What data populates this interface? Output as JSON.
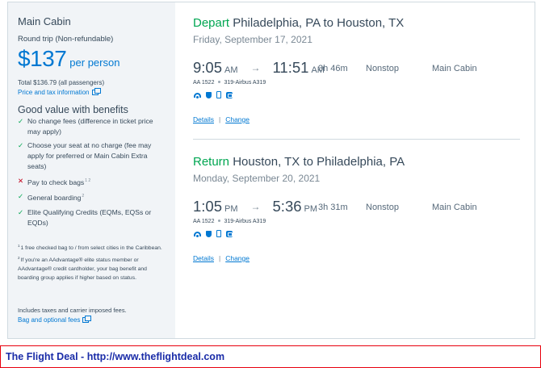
{
  "sidebar": {
    "cabin": "Main Cabin",
    "trip_type": "Round trip (Non-refundable)",
    "price": "$137",
    "per_person": "per person",
    "total": "Total $136.79 (all passengers)",
    "price_info_link": "Price and tax information",
    "benefits_title": "Good value with benefits",
    "benefits": [
      {
        "text": "No change fees (difference in ticket price may apply)",
        "included": true
      },
      {
        "text": "Choose your seat at no charge (fee may apply for preferred or Main Cabin Extra seats)",
        "included": true
      },
      {
        "text": "Pay to check bags",
        "included": false,
        "sup": "1 2"
      },
      {
        "text": "General boarding",
        "included": true,
        "sup": "2"
      },
      {
        "text": "Elite Qualifying Credits (EQMs, EQSs or EQDs)",
        "included": true
      }
    ],
    "notes": [
      {
        "sup": "1",
        "text": "1 free checked bag to / from select cities in the Caribbean."
      },
      {
        "sup": "2",
        "text": "If you're an AAdvantage® elite status member or AAdvantage® credit cardholder, your bag benefit and boarding group applies if higher based on status."
      }
    ],
    "includes": "Includes taxes and carrier imposed fees.",
    "bag_link": "Bag and optional fees"
  },
  "legs": [
    {
      "verb": "Depart",
      "route": "Philadelphia, PA to Houston, TX",
      "date": "Friday, September 17, 2021",
      "dep_time": "9:05",
      "dep_ampm": "AM",
      "arr_time": "11:51",
      "arr_ampm": "AM",
      "duration": "3h 46m",
      "stops": "Nonstop",
      "cabin": "Main Cabin",
      "flight": "AA 1522",
      "aircraft": "319-Airbus A319",
      "details": "Details",
      "change": "Change"
    },
    {
      "verb": "Return",
      "route": "Houston, TX to Philadelphia, PA",
      "date": "Monday, September 20, 2021",
      "dep_time": "1:05",
      "dep_ampm": "PM",
      "arr_time": "5:36",
      "arr_ampm": "PM",
      "duration": "3h 31m",
      "stops": "Nonstop",
      "cabin": "Main Cabin",
      "flight": "AA 1522",
      "aircraft": "319-Airbus A319",
      "details": "Details",
      "change": "Change"
    }
  ],
  "arrow": "→",
  "separator": "|",
  "banner": "The Flight Deal - http://www.theflightdeal.com",
  "colors": {
    "accent": "#0078d2",
    "green": "#00a651",
    "red": "#c30019",
    "banner_border": "#e8000e",
    "banner_text": "#1a2ca8"
  }
}
